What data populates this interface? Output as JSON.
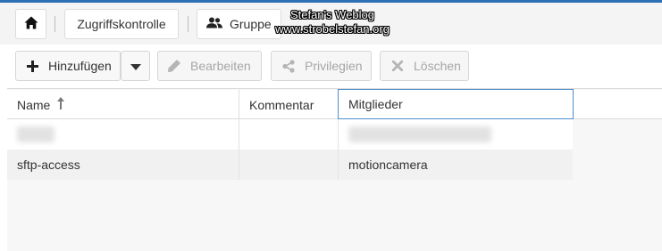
{
  "breadcrumb": {
    "home_icon": "home-icon",
    "items": [
      {
        "label": "Zugriffskontrolle"
      },
      {
        "label": "Gruppe",
        "icon": "users-icon"
      }
    ]
  },
  "watermark": {
    "line1": "Stefan's Weblog",
    "line2": "www.strobelstefan.org"
  },
  "toolbar": {
    "add_label": "Hinzufügen",
    "edit_label": "Bearbeiten",
    "privileges_label": "Privilegien",
    "delete_label": "Löschen"
  },
  "grid": {
    "columns": [
      "Name",
      "Kommentar",
      "Mitglieder"
    ],
    "sort": {
      "column": "Name",
      "direction": "ascending"
    },
    "rows": [
      {
        "name": "",
        "comment": "",
        "members": "",
        "obscured": true
      },
      {
        "name": "sftp-access",
        "comment": "",
        "members": "motioncamera"
      }
    ]
  },
  "colors": {
    "accent": "#2f6fb6",
    "header_focus": "#4f8fd0",
    "disabled_text": "#a6a6a6"
  }
}
